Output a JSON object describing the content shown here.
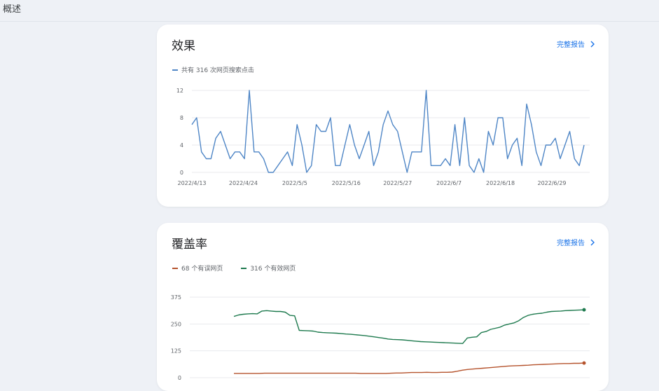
{
  "page": {
    "title": "概述"
  },
  "performance": {
    "title": "效果",
    "report_link": "完整报告",
    "legend": "共有 316 次网页搜索点击"
  },
  "coverage": {
    "title": "覆盖率",
    "report_link": "完整报告",
    "legend_errors": "68 个有误网页",
    "legend_valid": "316 个有效网页"
  },
  "colors": {
    "clicks": "#4f86c6",
    "errors": "#b5532d",
    "valid": "#1e7a4e",
    "link": "#1a73e8"
  },
  "icons": {
    "report_chevron": "chevron-right-icon"
  },
  "chart_data": [
    {
      "type": "line",
      "x_ticks": [
        "2022/4/13",
        "2022/4/24",
        "2022/5/5",
        "2022/5/16",
        "2022/5/27",
        "2022/6/7",
        "2022/6/18",
        "2022/6/29"
      ],
      "y_ticks": [
        "0",
        "4",
        "8",
        "12"
      ],
      "ylim": [
        0,
        12
      ],
      "grid": true,
      "series": [
        {
          "name": "共有 316 次网页搜索点击",
          "values": [
            7,
            8,
            3,
            2,
            2,
            5,
            6,
            4,
            2,
            3,
            3,
            2,
            12,
            3,
            3,
            2,
            0,
            0,
            1,
            2,
            3,
            1,
            7,
            4,
            0,
            1,
            7,
            6,
            6,
            8,
            1,
            1,
            4,
            7,
            4,
            2,
            4,
            6,
            1,
            3,
            7,
            9,
            7,
            6,
            3,
            0,
            3,
            3,
            3,
            12,
            1,
            1,
            1,
            2,
            1,
            7,
            1,
            8,
            1,
            0,
            2,
            0,
            6,
            4,
            8,
            8,
            2,
            4,
            5,
            1,
            10,
            7,
            3,
            1,
            4,
            4,
            5,
            2,
            4,
            6,
            2,
            1,
            4
          ]
        }
      ]
    },
    {
      "type": "line",
      "y_ticks": [
        "0",
        "125",
        "250",
        "375"
      ],
      "ylim": [
        0,
        375
      ],
      "grid": true,
      "series": [
        {
          "name": "316 个有效网页",
          "values": [
            285,
            292,
            295,
            297,
            298,
            297,
            310,
            312,
            310,
            308,
            308,
            305,
            290,
            288,
            220,
            219,
            218,
            217,
            212,
            210,
            209,
            208,
            207,
            205,
            203,
            202,
            200,
            198,
            196,
            193,
            190,
            187,
            184,
            180,
            178,
            177,
            176,
            174,
            172,
            170,
            168,
            167,
            166,
            165,
            164,
            163,
            162,
            161,
            160,
            159,
            185,
            188,
            190,
            210,
            215,
            225,
            230,
            235,
            245,
            250,
            255,
            265,
            280,
            290,
            295,
            298,
            300,
            305,
            308,
            309,
            310,
            312,
            313,
            314,
            315,
            316
          ]
        },
        {
          "name": "68 个有误网页",
          "values": [
            20,
            20,
            20,
            20,
            20,
            20,
            21,
            21,
            21,
            21,
            21,
            21,
            21,
            21,
            21,
            21,
            21,
            21,
            21,
            21,
            21,
            21,
            21,
            21,
            21,
            20,
            20,
            20,
            20,
            20,
            20,
            21,
            22,
            22,
            23,
            24,
            24,
            24,
            25,
            24,
            24,
            25,
            25,
            26,
            30,
            35,
            38,
            40,
            42,
            44,
            46,
            48,
            50,
            52,
            54,
            55,
            56,
            57,
            58,
            60,
            61,
            62,
            63,
            64,
            65,
            66,
            66,
            67,
            67,
            68
          ]
        }
      ]
    }
  ]
}
